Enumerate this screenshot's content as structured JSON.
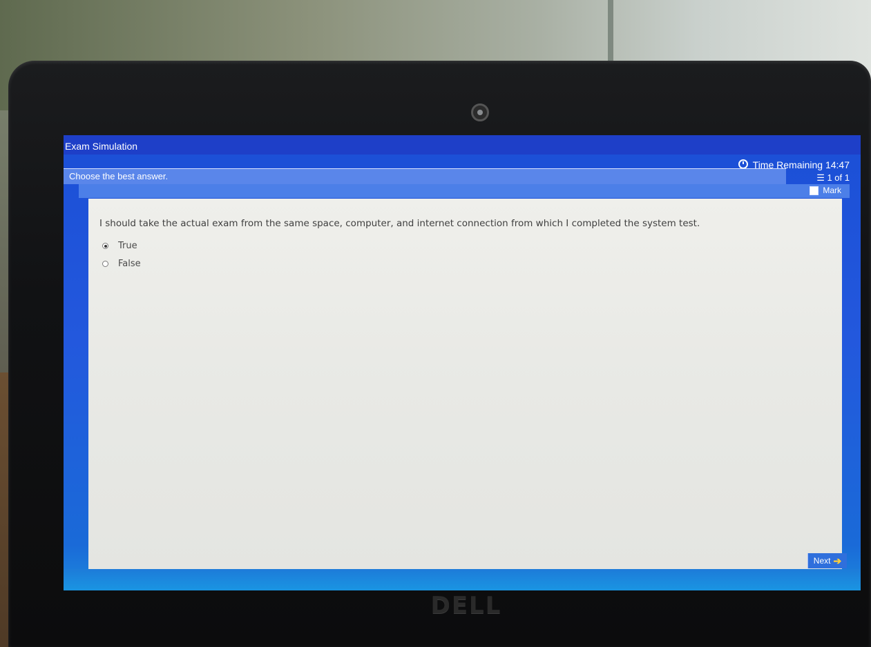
{
  "window": {
    "title": "Exam Simulation"
  },
  "header": {
    "time_remaining_label": "Time Remaining",
    "time_remaining_value": "14:47",
    "question_counter": "1 of 1"
  },
  "instruction": "Choose the best answer.",
  "mark": {
    "label": "Mark",
    "checked": false
  },
  "question": {
    "text": "I should take the actual exam from the same space, computer, and internet connection from which I completed the system test.",
    "options": [
      {
        "label": "True",
        "selected": true
      },
      {
        "label": "False",
        "selected": false
      }
    ]
  },
  "navigation": {
    "next_label": "Next"
  },
  "device": {
    "brand": "DELL"
  },
  "icons": {
    "timer": "clock-icon",
    "counter": "list-icon",
    "next": "arrow-right-icon"
  },
  "colors": {
    "screen_blue": "#1e3fc8",
    "instruction_bar": "#5a86ea",
    "content_bg": "#efefeb",
    "next_arrow": "#ffcf3a"
  }
}
